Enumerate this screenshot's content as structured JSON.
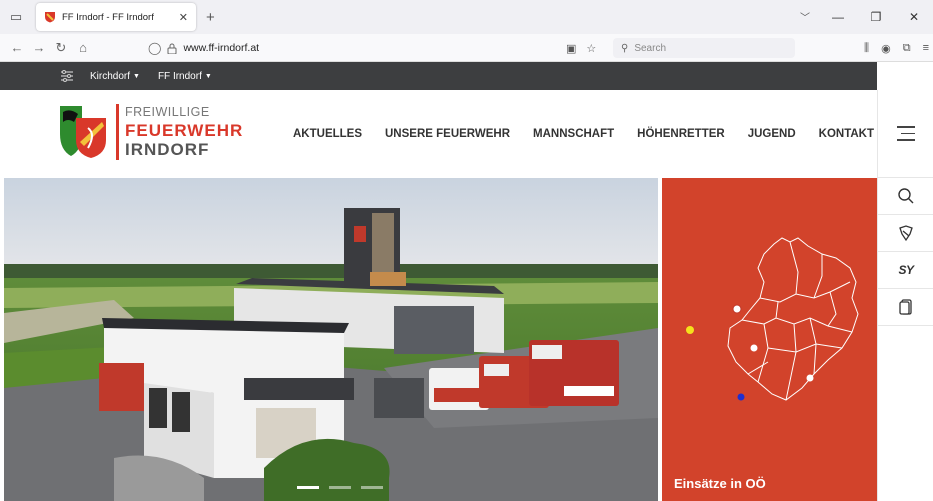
{
  "browser": {
    "tab_title": "FF Irndorf - FF Irndorf",
    "url_host": "www.ff-irndorf.at",
    "search_placeholder": "Search"
  },
  "topbar": {
    "dropdown1": "Kirchdorf",
    "dropdown2": "FF Irndorf"
  },
  "logo": {
    "line1": "FREIWILLIGE",
    "line2": "FEUERWEHR",
    "line3": "IRNDORF"
  },
  "nav": [
    "AKTUELLES",
    "UNSERE FEUERWEHR",
    "MANNSCHAFT",
    "HÖHENRETTER",
    "JUGEND",
    "KONTAKT"
  ],
  "map": {
    "title": "Einsätze in OÖ",
    "marker_colors": [
      "#f5e11c",
      "#ffffff",
      "#ffffff",
      "#ffffff",
      "#1e2fd0"
    ]
  },
  "rail_icons": [
    "menu-icon",
    "search-icon",
    "badge-icon",
    "sy-icon",
    "phone-icon"
  ],
  "hero": {
    "slides": 3,
    "active_slide": 1
  },
  "colors": {
    "brand_red": "#d9382a",
    "topbar": "#3d3e40",
    "map_bg": "#d2432b"
  }
}
